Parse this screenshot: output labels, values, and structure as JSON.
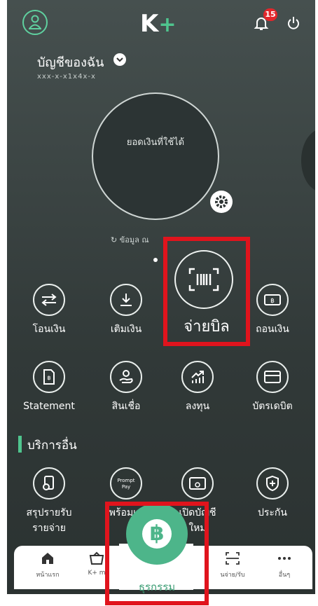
{
  "header": {
    "logo_k": "K",
    "logo_plus": "+",
    "notification_count": "15"
  },
  "account": {
    "name": "บัญชีของฉัน",
    "number_masked": "xxx-x-x1x4x-x"
  },
  "balance": {
    "label": "ยอดเงินที่ใช้ได้"
  },
  "refresh_text": "ข้อมูล ณ",
  "services_row1": [
    {
      "label": "โอนเงิน",
      "icon": "transfer-icon"
    },
    {
      "label": "เติมเงิน",
      "icon": "topup-icon"
    },
    {
      "label": "จ่ายบิล",
      "icon": "barcode-scan-icon"
    },
    {
      "label": "ถอนเงิน",
      "icon": "withdraw-icon"
    }
  ],
  "services_row2": [
    {
      "label": "Statement",
      "icon": "statement-icon"
    },
    {
      "label": "สินเชื่อ",
      "icon": "loan-icon"
    },
    {
      "label": "ลงทุน",
      "icon": "invest-icon"
    },
    {
      "label": "บัตรเดบิต",
      "icon": "debit-card-icon"
    }
  ],
  "other_services": {
    "title": "บริการอื่น",
    "items": [
      {
        "label": "สรุปรายรับ",
        "label2": "รายจ่าย",
        "icon": "summary-icon"
      },
      {
        "label": "พร้อมเพ",
        "icon": "promptpay-icon",
        "badge": "Prompt Pay"
      },
      {
        "label": "เปิดบัญชี",
        "label2": "ใหม่",
        "icon": "open-account-icon"
      },
      {
        "label": "ประกัน",
        "icon": "insurance-icon"
      }
    ]
  },
  "bottom_nav": [
    {
      "label": "หน้าแรก",
      "icon": "home-icon"
    },
    {
      "label": "K+ m",
      "icon": "market-icon"
    },
    {
      "label": "ธุรกรรม",
      "icon": "baht-coin-icon"
    },
    {
      "label": "นจ่าย/รับ",
      "icon": "scan-icon"
    },
    {
      "label": "อื่นๆ",
      "icon": "more-icon"
    }
  ],
  "colors": {
    "brand_green": "#4fc58e",
    "highlight_red": "#e0141d",
    "background": "#3a4342"
  }
}
